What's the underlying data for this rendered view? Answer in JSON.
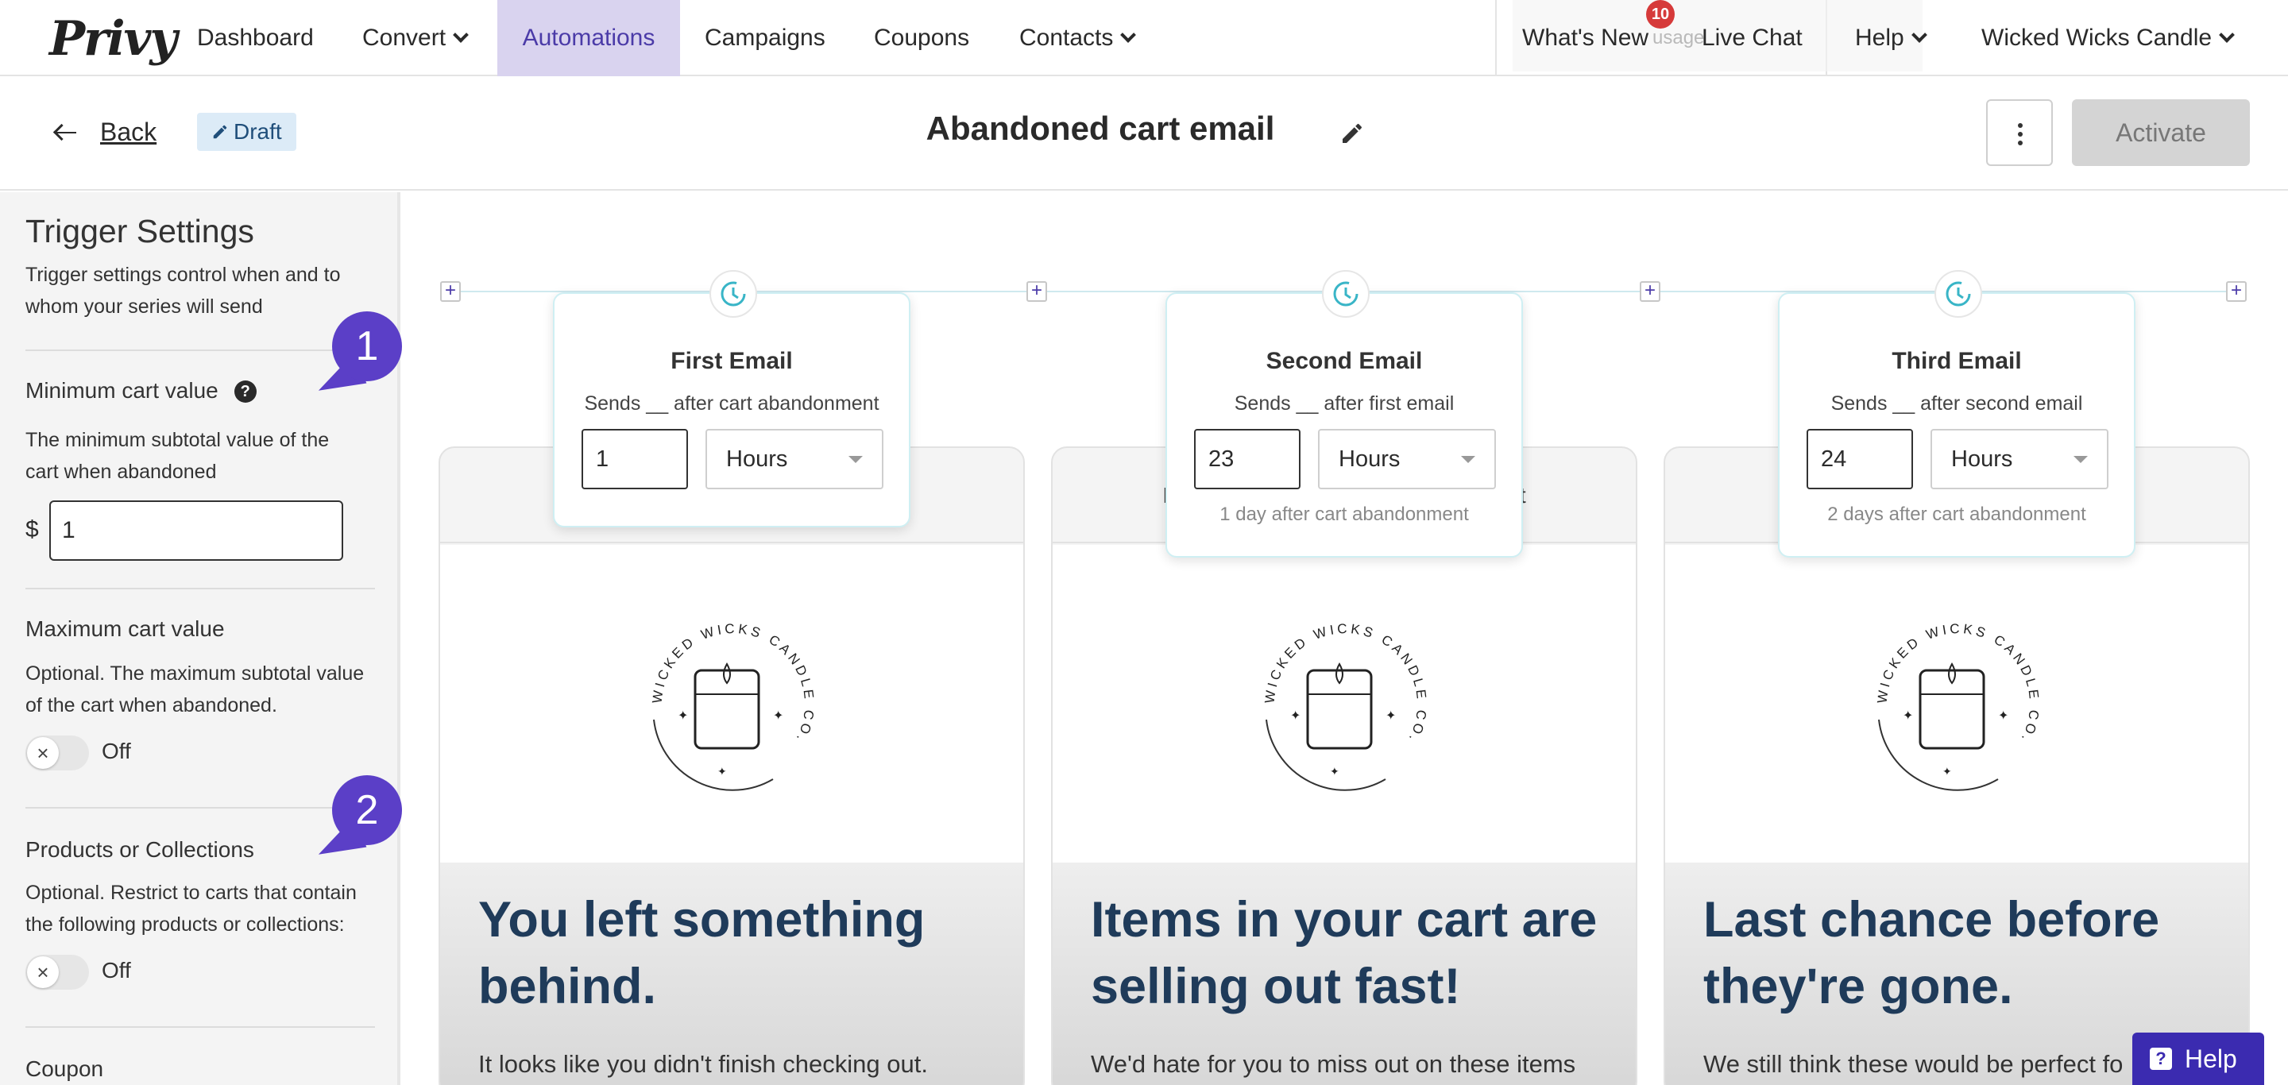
{
  "nav": {
    "logo": "Privy",
    "items": [
      {
        "label": "Dashboard",
        "dropdown": false
      },
      {
        "label": "Convert",
        "dropdown": true
      },
      {
        "label": "Automations",
        "dropdown": false,
        "active": true
      },
      {
        "label": "Campaigns",
        "dropdown": false
      },
      {
        "label": "Coupons",
        "dropdown": false
      },
      {
        "label": "Contacts",
        "dropdown": true
      }
    ],
    "whats_new": "What's New",
    "whats_new_badge": "10",
    "ghost_text": "usage",
    "live_chat": "Live Chat",
    "help": "Help",
    "account": "Wicked Wicks Candle"
  },
  "header": {
    "back_label": "Back",
    "status": "Draft",
    "title": "Abandoned cart email",
    "activate_label": "Activate"
  },
  "sidebar": {
    "title": "Trigger Settings",
    "description": "Trigger settings control when and to whom your series will send",
    "min_cart": {
      "label": "Minimum cart value",
      "help": "?",
      "description": "The minimum subtotal value of the cart when abandoned",
      "currency": "$",
      "value": "1"
    },
    "max_cart": {
      "label": "Maximum cart value",
      "description": "Optional. The maximum subtotal value of the cart when abandoned.",
      "toggle": "Off"
    },
    "products": {
      "label": "Products or Collections",
      "description": "Optional. Restrict to carts that contain the following products or collections:",
      "toggle": "Off"
    },
    "coupon_label": "Coupon",
    "callouts": [
      "1",
      "2"
    ]
  },
  "emails": [
    {
      "step_title": "First Email",
      "step_sub": "Sends __ after cart abandonment",
      "amount": "1",
      "unit": "Hours",
      "note": "",
      "card_header": "",
      "headline": "You left something behind.",
      "body": "It looks like you didn't finish checking out."
    },
    {
      "step_title": "Second Email",
      "step_sub": "Sends __ after first email",
      "amount": "23",
      "unit": "Hours",
      "note": "1 day after cart abandonment",
      "card_header": "It                                                      st",
      "headline": "Items in your cart are selling out fast!",
      "body": "We'd hate for you to miss out on these items"
    },
    {
      "step_title": "Third Email",
      "step_sub": "Sends __ after second email",
      "amount": "24",
      "unit": "Hours",
      "note": "2 days after cart abandonment",
      "card_header": "",
      "headline": "Last chance before they're gone.",
      "body": "We still think these would be perfect fo"
    }
  ],
  "logo_text": "WICKED WICKS CANDLE CO.",
  "help_button": "Help",
  "colors": {
    "brand_purple": "#5b3fc7",
    "active_nav_bg": "#d9d3ef",
    "headline": "#1f3b5a",
    "draft_bg": "#dcebf7"
  }
}
